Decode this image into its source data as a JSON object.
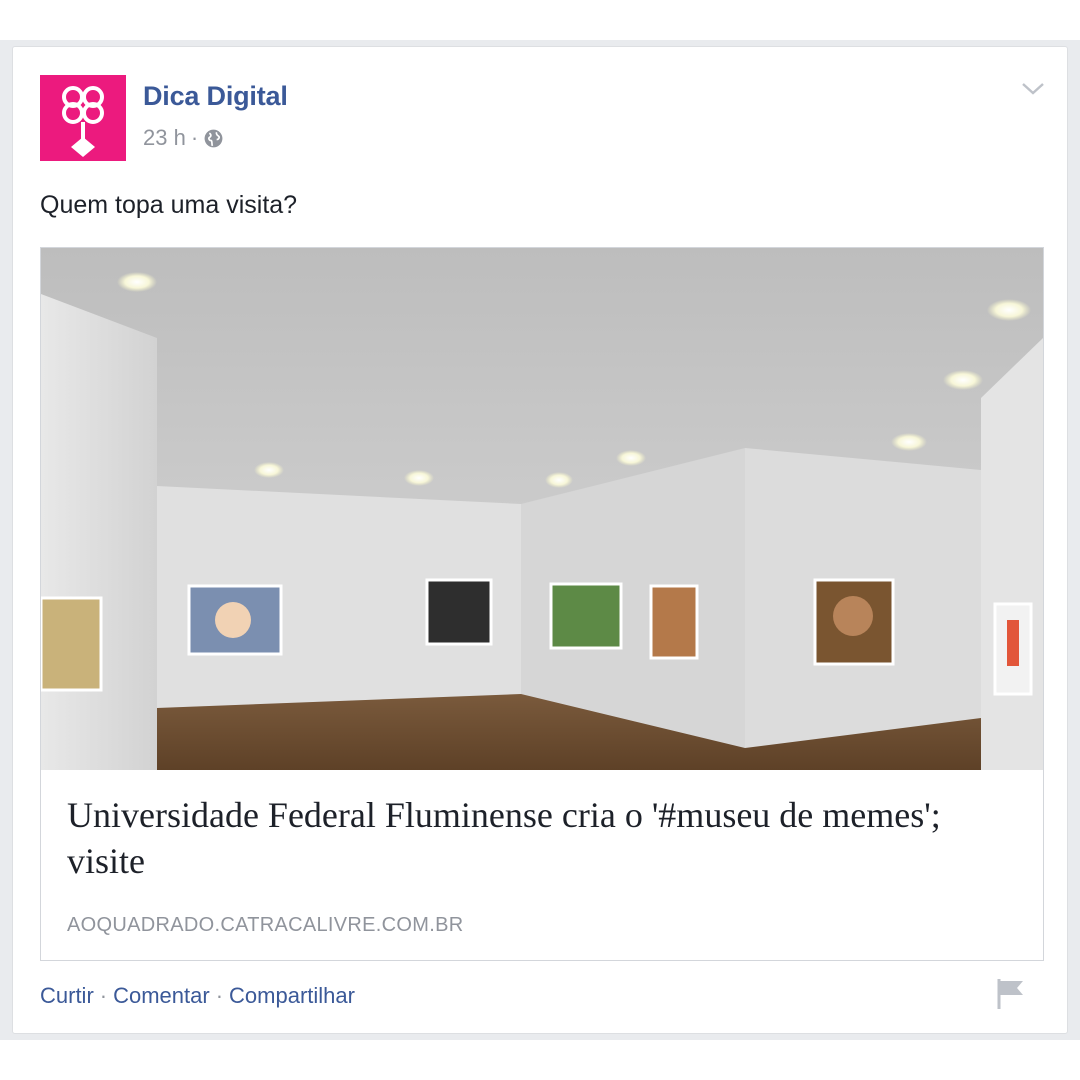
{
  "post": {
    "page_name": "Dica Digital",
    "time": "23 h",
    "separator": "·",
    "text": "Quem topa uma visita?"
  },
  "link": {
    "title": "Universidade Federal Fluminense cria o '#museu de memes'; visite",
    "domain": "AOQUADRADO.CATRACALIVRE.COM.BR"
  },
  "actions": {
    "like": "Curtir",
    "comment": "Comentar",
    "share": "Compartilhar",
    "separator": "·"
  },
  "icons": {
    "avatar": "dica-digital-logo",
    "privacy": "globe-icon",
    "menu": "chevron-down-icon",
    "report": "flag-icon"
  },
  "colors": {
    "link_blue": "#3b5998",
    "meta_gray": "#90949c",
    "brand_pink": "#ec1a7e"
  }
}
